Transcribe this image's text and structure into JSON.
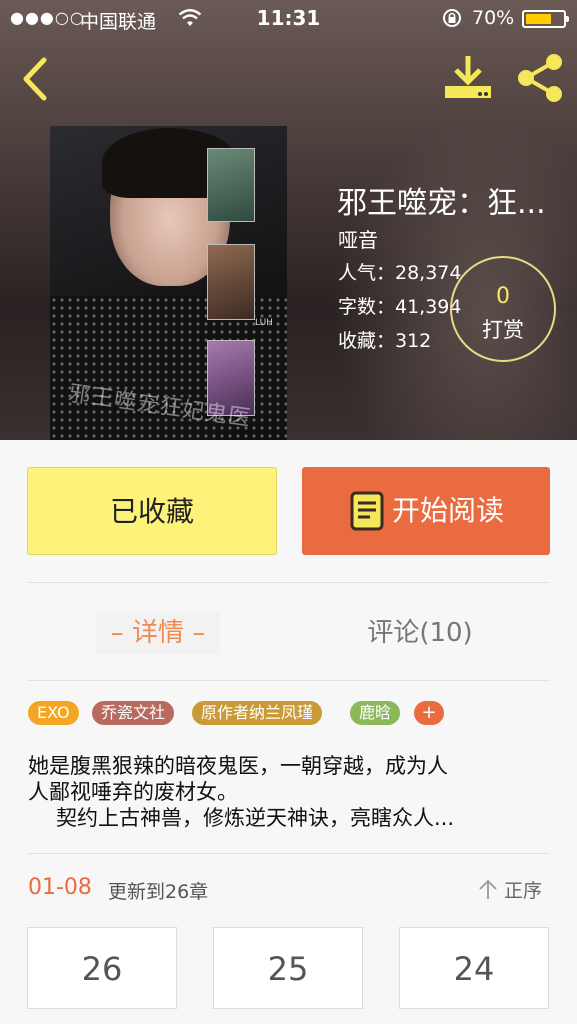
{
  "status_bar": {
    "signal": "●●●○○",
    "carrier": "中国联通",
    "time": "11:31",
    "battery_percent": "70%",
    "battery_level": 0.7,
    "battery_color": "#ffcc00"
  },
  "book": {
    "cover_title_text": "邪王噬宠狂妃鬼医",
    "cover_tag": "LUH",
    "title": "邪王噬宠：狂...",
    "author": "哑音",
    "stats": {
      "popularity": "人气：28,374",
      "word_count": "字数：41,394",
      "favorites": "收藏：312"
    },
    "tip": {
      "count": "0",
      "label": "打赏"
    }
  },
  "actions": {
    "favorited_label": "已收藏",
    "start_reading_label": "开始阅读"
  },
  "tabs": {
    "details": "– 详情 –",
    "comments": "评论(10)"
  },
  "tags": [
    "EXO",
    "乔瓷文社",
    "原作者纳兰凤瑾",
    "鹿晗",
    "+"
  ],
  "synopsis": {
    "line1": "她是腹黑狠辣的暗夜鬼医，一朝穿越，成为人",
    "line2": "人鄙视唾弃的废材女。",
    "line3": "契约上古神兽，修炼逆天神诀，亮瞎众人..."
  },
  "updates": {
    "date": "01-08",
    "text": "更新到26章",
    "sort_label": "正序"
  },
  "chapters": [
    "26",
    "25",
    "24"
  ],
  "colors": {
    "accent_orange": "#ea6b3f",
    "favorite_yellow": "#fdf27a",
    "icon_yellow": "#f5e75a"
  }
}
